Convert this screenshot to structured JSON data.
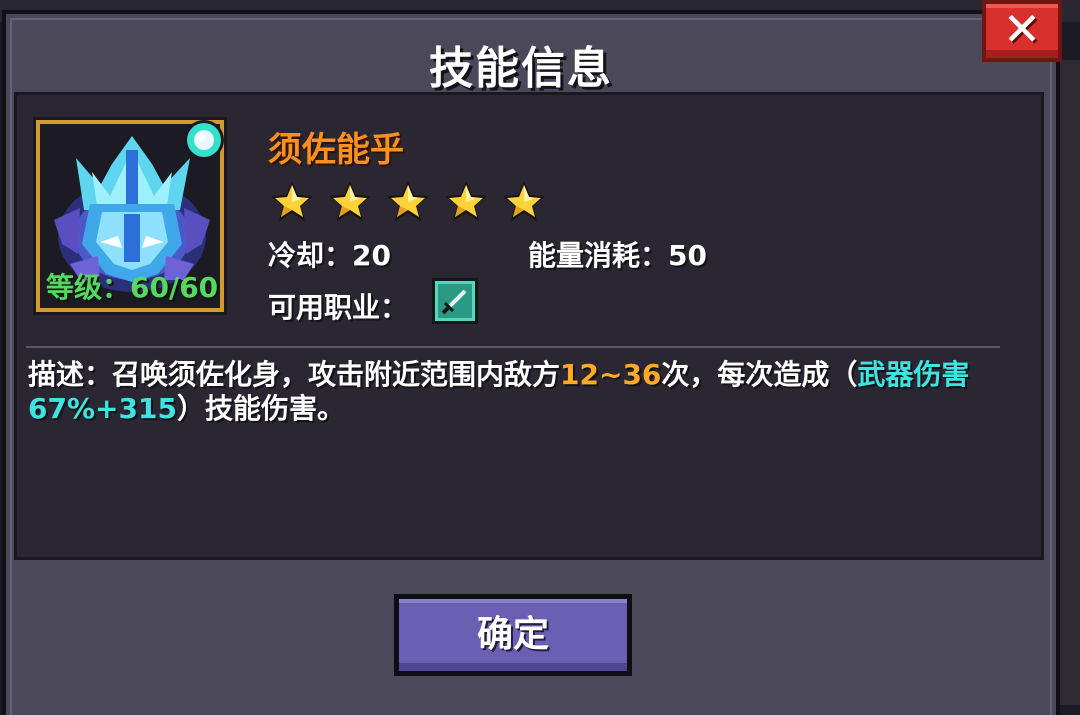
{
  "dialog": {
    "title": "技能信息",
    "close_label": "✕",
    "confirm_label": "确定"
  },
  "skill": {
    "name": "须佐能乎",
    "stars": 5,
    "stars_max": 5,
    "level_text": "等级：60/60",
    "icon": "susanoo-icon",
    "cooldown_label": "冷却：",
    "cooldown_value": "20",
    "energy_label": "能量消耗：",
    "energy_value": "50",
    "job_label": "可用职业：",
    "job_icon": "sword-class-icon"
  },
  "description": {
    "prefix": "描述：召唤须佐化身，攻击附近范围内敌方",
    "hit_range": "12~36",
    "mid": "次，每次造成（",
    "damage": "武器伤害67%+315",
    "suffix": "）技能伤害。"
  },
  "colors": {
    "panel": "#4b4859",
    "content": "#2a2732",
    "skill_name": "#ff8f1e",
    "level": "#54d860",
    "highlight_orange": "#ffaa22",
    "highlight_cyan": "#3ee4e0",
    "close_button": "#d8302c",
    "confirm_button": "#6a5fb2"
  }
}
